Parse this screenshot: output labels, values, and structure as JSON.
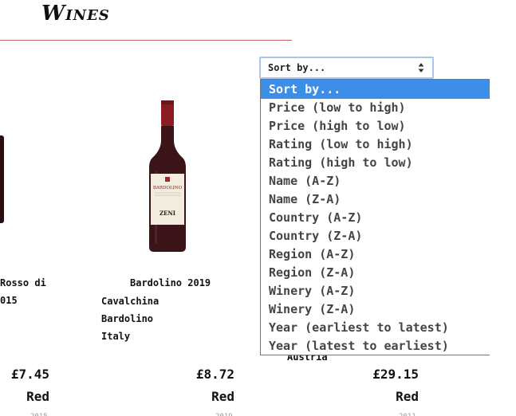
{
  "page": {
    "title": "Wines"
  },
  "sort": {
    "selected": "Sort by...",
    "options": [
      "Sort by...",
      "Price (low to high)",
      "Price (high to low)",
      "Rating (low to high)",
      "Rating (high to low)",
      "Name (A-Z)",
      "Name (Z-A)",
      "Country (A-Z)",
      "Country (Z-A)",
      "Region (A-Z)",
      "Region (Z-A)",
      "Winery (A-Z)",
      "Winery (Z-A)",
      "Year (earliest to latest)",
      "Year (latest to earliest)"
    ]
  },
  "products": [
    {
      "name_line1": "Rosso di",
      "name_line2": "015",
      "price": "£7.45",
      "colour": "Red"
    },
    {
      "name": "Bardolino 2019",
      "winery": "Cavalchina",
      "region": "Bardolino",
      "country": "Italy",
      "price": "£8.72",
      "colour": "Red",
      "bottle_label": "BARDOLINO",
      "bottle_brand": "ZENI"
    },
    {
      "country": "Austria",
      "price": "£29.15",
      "colour": "Red"
    }
  ],
  "colors": {
    "accent_rule": "#c9675e",
    "dropdown_highlight": "#3d8ee8",
    "select_border": "#a9c6f0",
    "bottle_glass": "#3a1418",
    "bottle_capsule": "#8c1c24"
  },
  "icons": {
    "select_arrows": "up-down-caret-icon"
  }
}
